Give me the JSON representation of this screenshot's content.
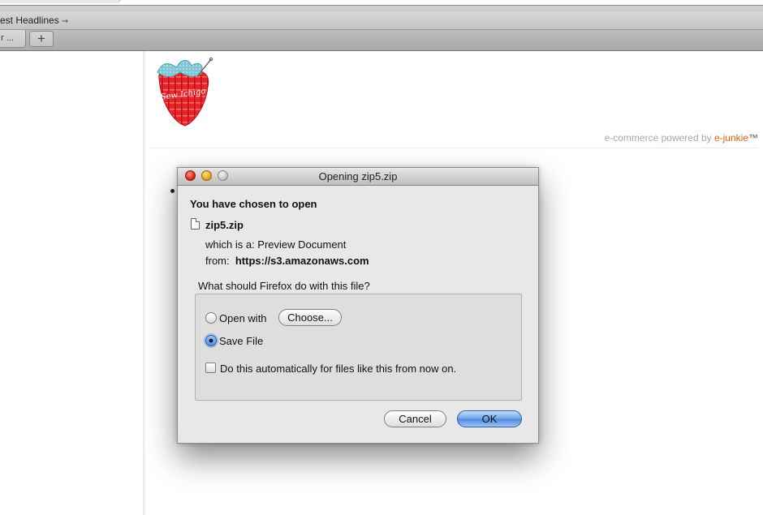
{
  "bookmarks_bar": {
    "item_label": "est Headlines",
    "item_icon": "rss-icon"
  },
  "tab_bar": {
    "tab_label": "r ...",
    "new_tab_label": "+"
  },
  "page": {
    "powered_prefix": "e-commerce powered by ",
    "powered_brand": "e-junkie",
    "powered_tm": "™",
    "brand_color": "#e06010",
    "logo_text": "Sew Ichigo"
  },
  "dialog": {
    "title": "Opening zip5.zip",
    "heading": "You have chosen to open",
    "file_icon": "document-icon",
    "filename": "zip5.zip",
    "which_is_a": "which is a:  Preview Document",
    "from_label": "from:",
    "from_value": "https://s3.amazonaws.com",
    "question": "What should Firefox do with this file?",
    "open_with_label": "Open with",
    "choose_button": "Choose...",
    "save_file_label": "Save File",
    "selected_option": "Save File",
    "auto_checkbox_label": "Do this automatically for files like this from now on.",
    "auto_checked": false,
    "cancel_button": "Cancel",
    "ok_button": "OK"
  }
}
